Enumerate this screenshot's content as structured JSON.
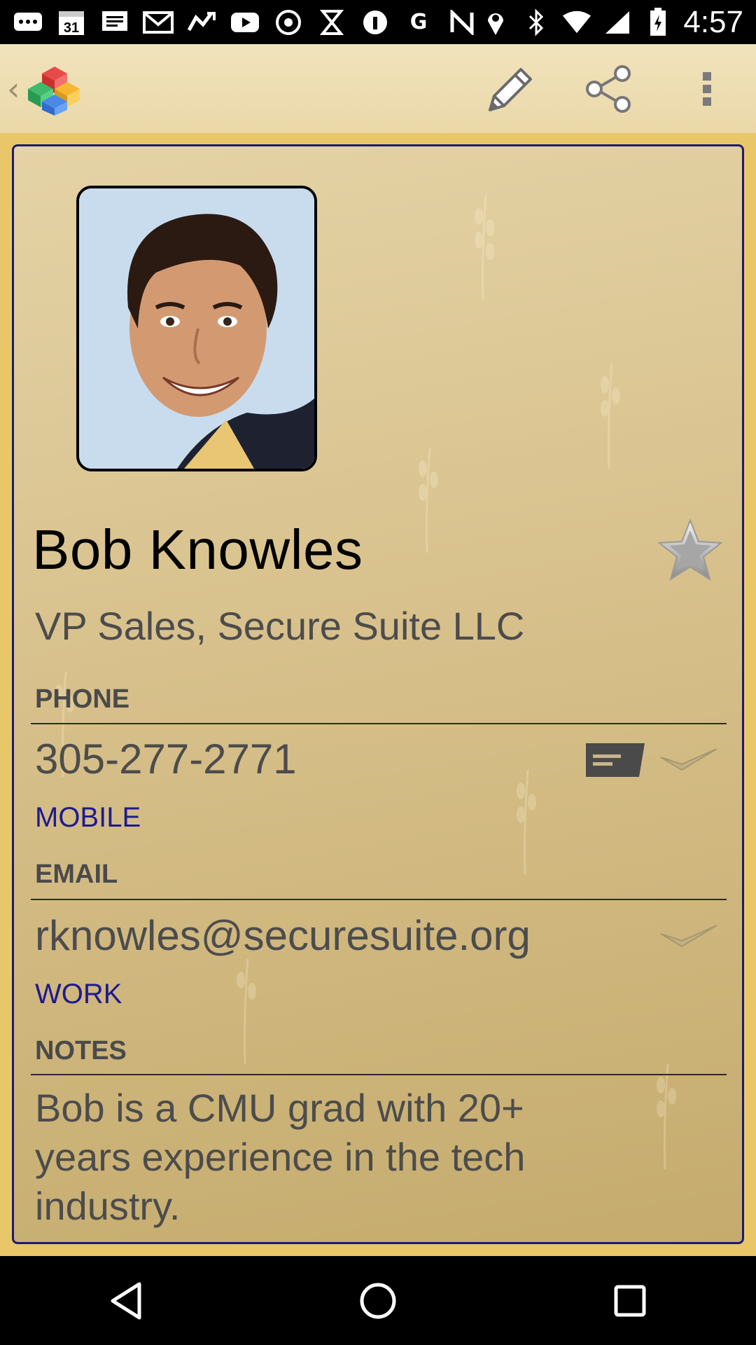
{
  "status_bar": {
    "calendar_day": "31",
    "clock": "4:57",
    "icons": [
      "messaging-icon",
      "calendar-icon",
      "notes-icon",
      "gmail-icon",
      "maps-icon",
      "youtube-icon",
      "sync-icon",
      "hourglass-icon",
      "location-pin-icon",
      "google-icon",
      "nfc-icon",
      "location-icon",
      "bluetooth-icon",
      "wifi-icon",
      "signal-icon",
      "battery-icon"
    ]
  },
  "app_bar": {
    "actions": [
      "edit-icon",
      "share-icon",
      "overflow-menu-icon"
    ]
  },
  "contact": {
    "name": "Bob Knowles",
    "title": "VP Sales, Secure Suite LLC",
    "phone_section_label": "PHONE",
    "phone_number": "305-277-2771",
    "phone_type": "MOBILE",
    "email_section_label": "EMAIL",
    "email_address": "rknowles@securesuite.org",
    "email_type": "WORK",
    "notes_section_label": "NOTES",
    "notes": "Bob is a CMU grad with 20+ years experience in the tech industry."
  },
  "colors": {
    "card_border": "#1f1a73",
    "type_label": "#1f1a8f",
    "background": "#e9c768"
  }
}
